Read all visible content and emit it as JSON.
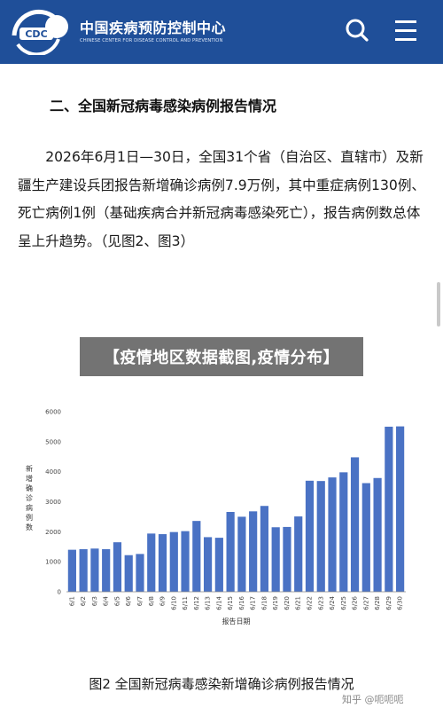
{
  "header": {
    "logo_text": "CDC",
    "brand_cn": "中国疾病预防控制中心",
    "brand_en": "CHINESE CENTER FOR DISEASE CONTROL AND PREVENTION",
    "search_icon": "search-icon",
    "menu_icon": "hamburger-menu-icon",
    "background_color": "#1f4f99"
  },
  "article": {
    "section_title": "二、全国新冠病毒感染病例报告情况",
    "paragraph": "2026年6月1日—30日，全国31个省（自治区、直辖市）及新疆生产建设兵团报告新增确诊病例7.9万例，其中重症病例130例、死亡病例1例（基础疾病合并新冠病毒感染死亡），报告病例数总体呈上升趋势。（见图2、图3）"
  },
  "banner": {
    "text": "【疫情地区数据截图,疫情分布】"
  },
  "chart_data": {
    "type": "bar",
    "categories": [
      "6/1",
      "6/2",
      "6/3",
      "6/4",
      "6/5",
      "6/6",
      "6/7",
      "6/8",
      "6/9",
      "6/10",
      "6/11",
      "6/12",
      "6/13",
      "6/14",
      "6/15",
      "6/16",
      "6/17",
      "6/18",
      "6/19",
      "6/20",
      "6/21",
      "6/22",
      "6/23",
      "6/24",
      "6/25",
      "6/26",
      "6/27",
      "6/28",
      "6/29",
      "6/30"
    ],
    "values": [
      1400,
      1420,
      1440,
      1420,
      1650,
      1220,
      1260,
      1940,
      1920,
      1990,
      2020,
      2360,
      1820,
      1800,
      2660,
      2500,
      2680,
      2860,
      2150,
      2160,
      2510,
      3700,
      3690,
      3810,
      3980,
      4480,
      3620,
      3790,
      5500,
      5510
    ],
    "ylim": [
      0,
      6000
    ],
    "yticks": [
      0,
      1000,
      2000,
      3000,
      4000,
      5000,
      6000
    ],
    "xlabel": "报告日期",
    "ylabel": "新增确诊病例数",
    "title": "",
    "bar_color": "#4a72c4",
    "grid": false
  },
  "caption": {
    "text": "图2  全国新冠病毒感染新增确诊病例报告情况"
  },
  "watermark": {
    "text": "知乎 @呃呃呃"
  }
}
